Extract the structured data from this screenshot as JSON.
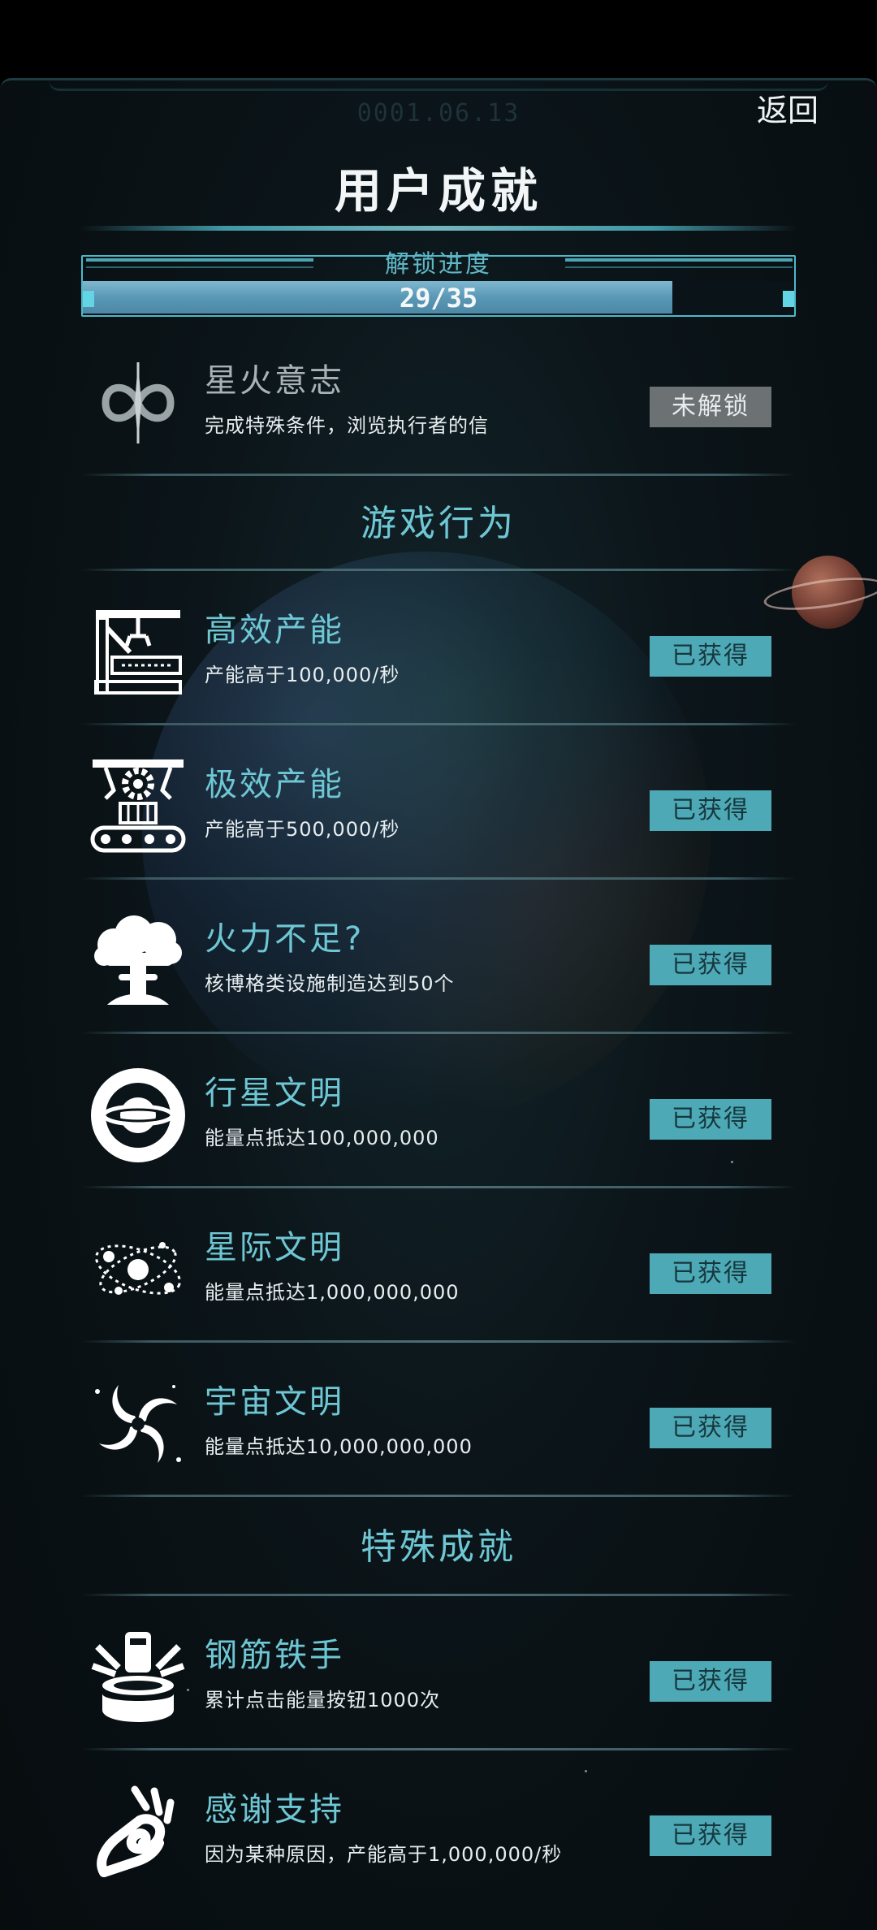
{
  "header": {
    "date": "0001.06.13",
    "back_label": "返回",
    "title": "用户成就"
  },
  "progress": {
    "label": "解锁进度",
    "text": "29/35",
    "fraction": 0.8286
  },
  "colors": {
    "accent": "#6ec7d4",
    "earned_badge": "#4ea9b6",
    "locked_badge": "#6c7274"
  },
  "special_top": {
    "name": "星火意志",
    "desc": "完成特殊条件，浏览执行者的信",
    "status": "未解锁",
    "icon": "infinity-icon"
  },
  "sections": {
    "game": "游戏行为",
    "special": "特殊成就"
  },
  "game_achievements": [
    {
      "name": "高效产能",
      "desc": "产能高于100,000/秒",
      "status": "已获得",
      "icon": "factory-arm-icon"
    },
    {
      "name": "极效产能",
      "desc": "产能高于500,000/秒",
      "status": "已获得",
      "icon": "conveyor-gear-icon"
    },
    {
      "name": "火力不足?",
      "desc": "核博格类设施制造达到50个",
      "status": "已获得",
      "icon": "mushroom-cloud-icon"
    },
    {
      "name": "行星文明",
      "desc": "能量点抵达100,000,000",
      "status": "已获得",
      "icon": "ringed-planet-icon"
    },
    {
      "name": "星际文明",
      "desc": "能量点抵达1,000,000,000",
      "status": "已获得",
      "icon": "orbit-system-icon"
    },
    {
      "name": "宇宙文明",
      "desc": "能量点抵达10,000,000,000",
      "status": "已获得",
      "icon": "spiral-galaxy-icon"
    }
  ],
  "special_achievements": [
    {
      "name": "钢筋铁手",
      "desc": "累计点击能量按钮1000次",
      "status": "已获得",
      "icon": "press-button-icon"
    },
    {
      "name": "感谢支持",
      "desc": "因为某种原因，产能高于1,000,000/秒",
      "status": "已获得",
      "icon": "ok-hand-icon"
    }
  ]
}
